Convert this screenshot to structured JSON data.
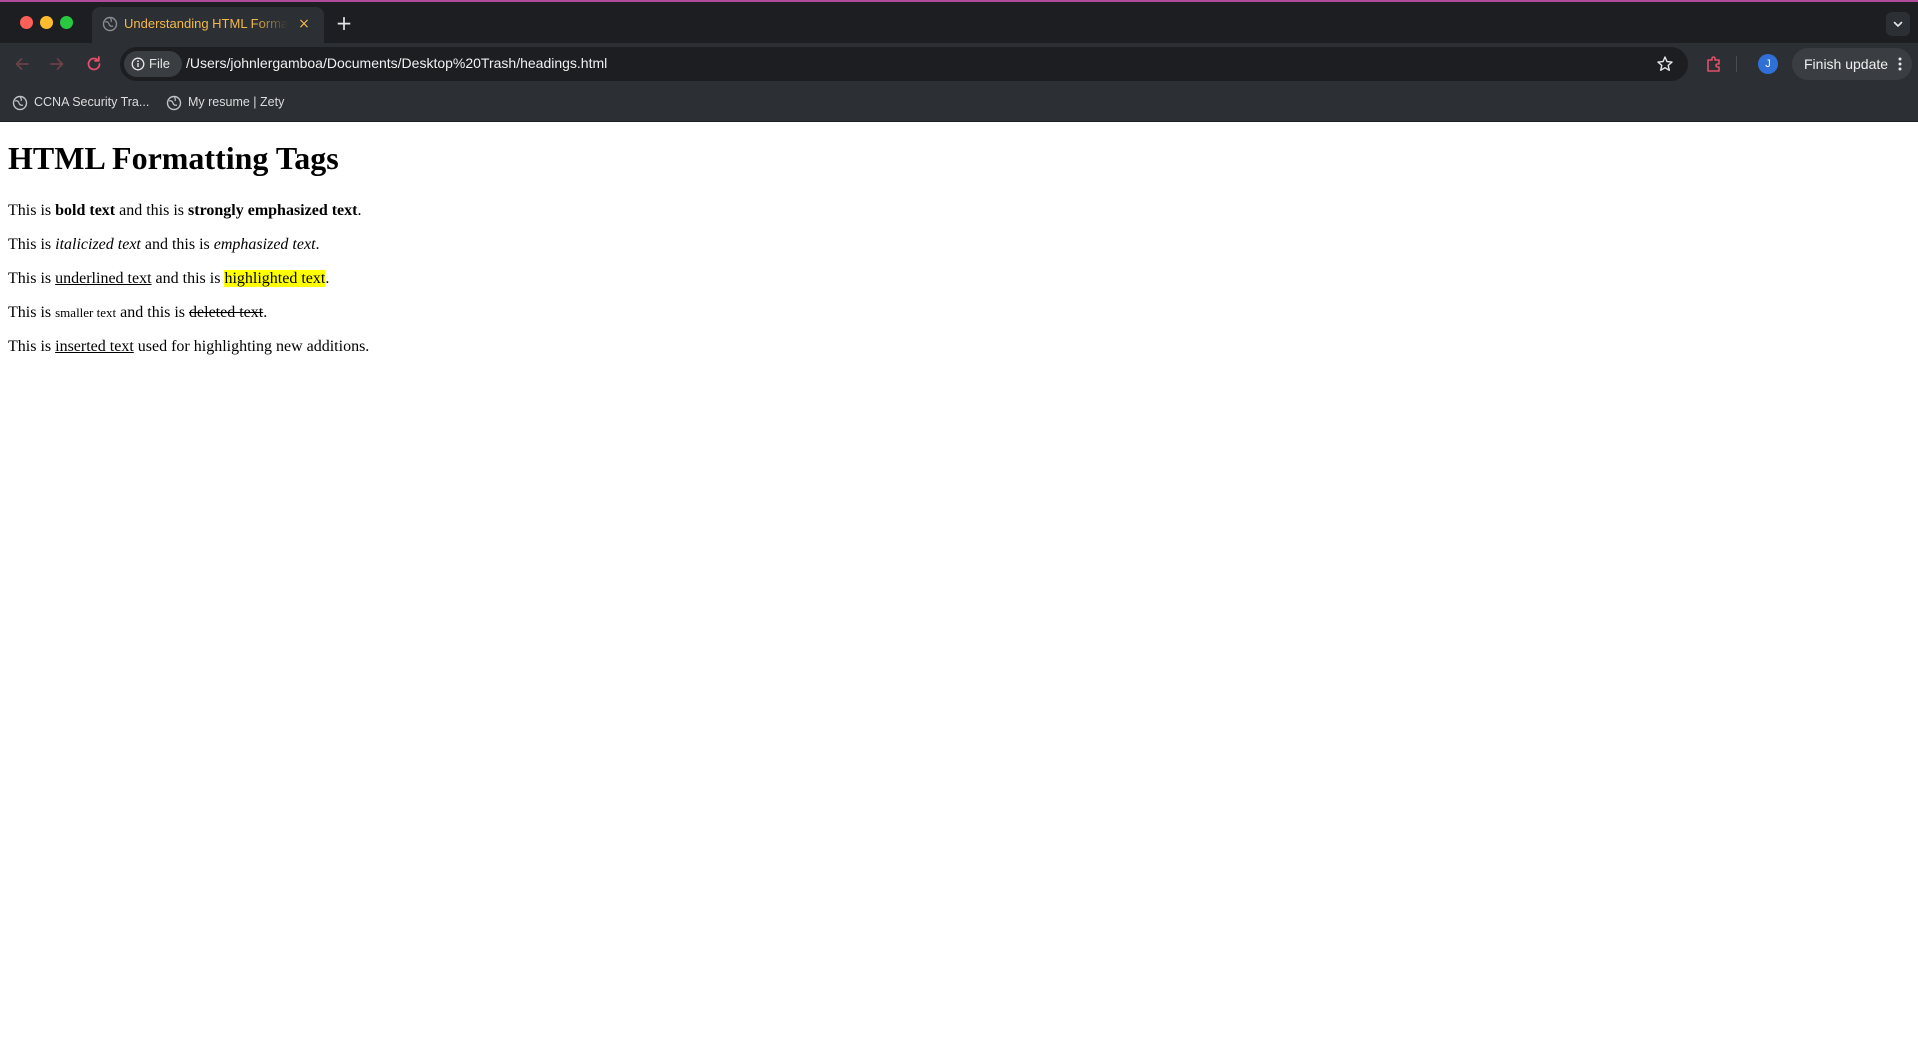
{
  "browser": {
    "tab": {
      "title": "Understanding HTML Formatting Tags",
      "close_glyph": "×",
      "favicon_icon": "globe-icon"
    },
    "new_tab_glyph": "+",
    "toolbar": {
      "security_chip_label": "File",
      "url": "/Users/johnlergamboa/Documents/Desktop%20Trash/headings.html",
      "profile_initial": "J",
      "finish_update_label": "Finish update"
    },
    "bookmarks": [
      {
        "label": "CCNA Security Tra...",
        "icon": "globe-icon"
      },
      {
        "label": "My resume | Zety",
        "icon": "globe-icon"
      }
    ],
    "colors": {
      "tab_title": "#f2b84b",
      "reload_icon": "#e0506a",
      "extension_icon": "#e0506a",
      "avatar": "#2f6fd6",
      "accent_line": "#b04a9c"
    }
  },
  "page": {
    "heading": "HTML Formatting Tags",
    "p1": {
      "a": "This is ",
      "bold": "bold text",
      "b": " and this is ",
      "strong": "strongly emphasized text",
      "c": "."
    },
    "p2": {
      "a": "This is ",
      "italic": "italicized text",
      "b": " and this is ",
      "em": "emphasized text",
      "c": "."
    },
    "p3": {
      "a": "This is ",
      "underline": "underlined text",
      "b": " and this is ",
      "mark": "highlighted text",
      "c": "."
    },
    "p4": {
      "a": "This is ",
      "small": "smaller text",
      "b": " and this is ",
      "del": "deleted text",
      "c": "."
    },
    "p5": {
      "a": "This is ",
      "ins": "inserted text",
      "b": " used for highlighting new additions."
    }
  }
}
